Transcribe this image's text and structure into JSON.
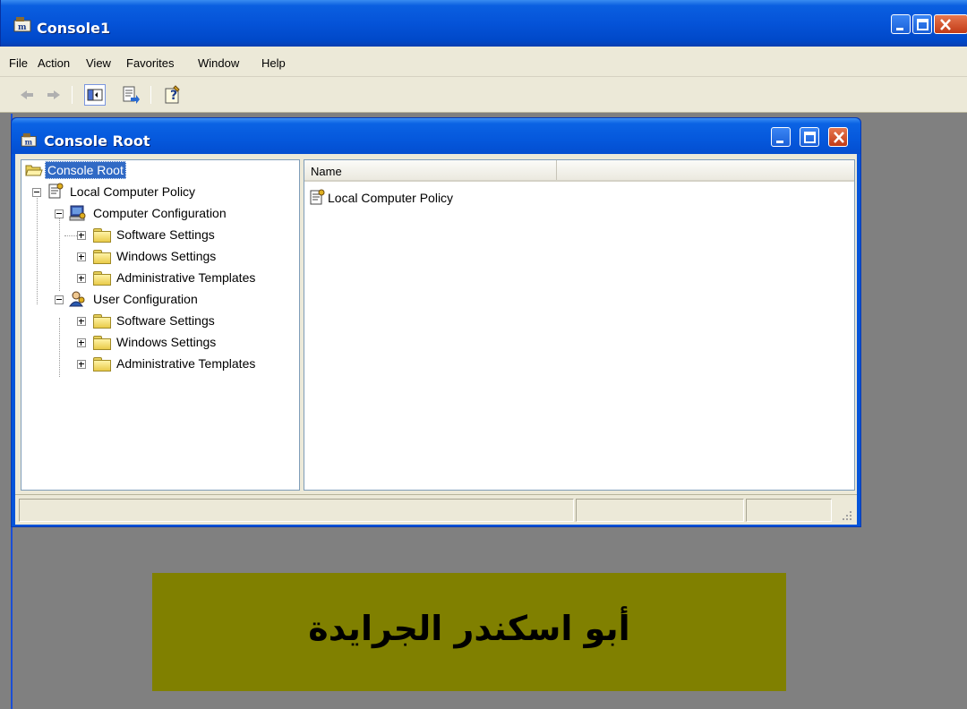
{
  "window": {
    "title": "Console1",
    "icon": "mmc-console-icon"
  },
  "menubar": {
    "items": [
      "File",
      "Action",
      "View",
      "Favorites",
      "Window",
      "Help"
    ]
  },
  "toolbar": {
    "buttons": [
      "back-arrow-icon",
      "forward-arrow-icon",
      "show-hide-tree-icon",
      "export-list-icon",
      "help-icon"
    ]
  },
  "child_window": {
    "title": "Console Root",
    "icon": "mmc-console-icon"
  },
  "tree": {
    "nodes": [
      {
        "label": "Console Root",
        "icon": "open-folder-icon",
        "selected": true
      },
      {
        "label": "Local Computer Policy",
        "icon": "policy-scroll-icon"
      },
      {
        "label": "Computer Configuration",
        "icon": "computer-config-icon"
      },
      {
        "label": "Software Settings",
        "icon": "folder-icon"
      },
      {
        "label": "Windows Settings",
        "icon": "folder-icon"
      },
      {
        "label": "Administrative Templates",
        "icon": "folder-icon"
      },
      {
        "label": "User Configuration",
        "icon": "user-config-icon"
      },
      {
        "label": "Software Settings",
        "icon": "folder-icon"
      },
      {
        "label": "Windows Settings",
        "icon": "folder-icon"
      },
      {
        "label": "Administrative Templates",
        "icon": "folder-icon"
      }
    ]
  },
  "list": {
    "columns": [
      "Name",
      ""
    ],
    "items": [
      {
        "label": "Local Computer Policy",
        "icon": "policy-scroll-icon"
      }
    ]
  },
  "banner": {
    "text": "أبو اسكندر الجرايدة",
    "color": "#808000"
  },
  "colors": {
    "xp_blue": "#0554d9",
    "selection": "#316ac5",
    "window_bg": "#ece9d8",
    "mdi_bg": "#808080"
  }
}
